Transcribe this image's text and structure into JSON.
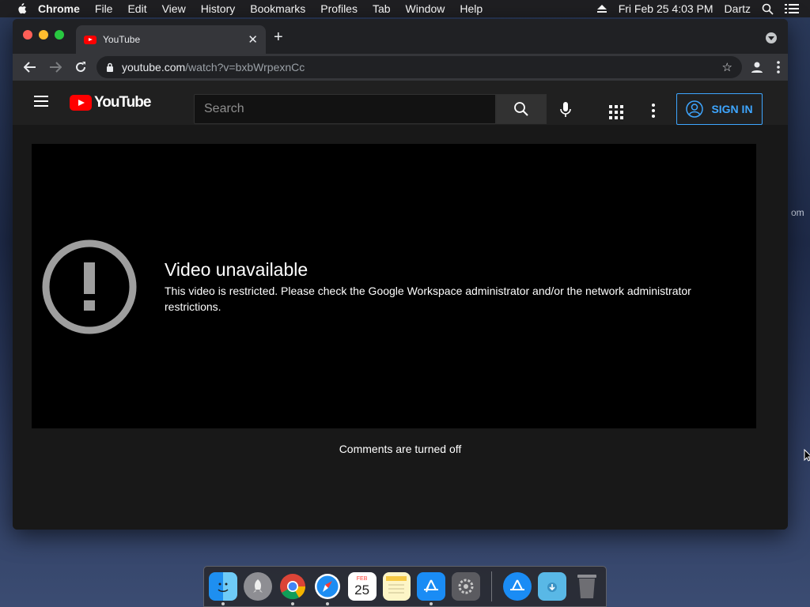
{
  "menubar": {
    "app": "Chrome",
    "items": [
      "File",
      "Edit",
      "View",
      "History",
      "Bookmarks",
      "Profiles",
      "Tab",
      "Window",
      "Help"
    ],
    "datetime": "Fri Feb 25  4:03 PM",
    "user": "Dartz"
  },
  "browser": {
    "tab_title": "YouTube",
    "url_host": "youtube.com",
    "url_path": "/watch?v=bxbWrpexnCc"
  },
  "youtube": {
    "logo_text": "YouTube",
    "search_placeholder": "Search",
    "signin_label": "SIGN IN",
    "error_title": "Video unavailable",
    "error_message": "This video is restricted. Please check the Google Workspace administrator and/or the network administrator restrictions.",
    "comments_status": "Comments are turned off"
  },
  "dock": {
    "calendar_month": "FEB",
    "calendar_day": "25"
  },
  "colors": {
    "accent_blue": "#3ea6ff",
    "youtube_red": "#ff0000",
    "error_icon": "#9e9e9e"
  },
  "desktop_peek": {
    "right_text": "om"
  }
}
